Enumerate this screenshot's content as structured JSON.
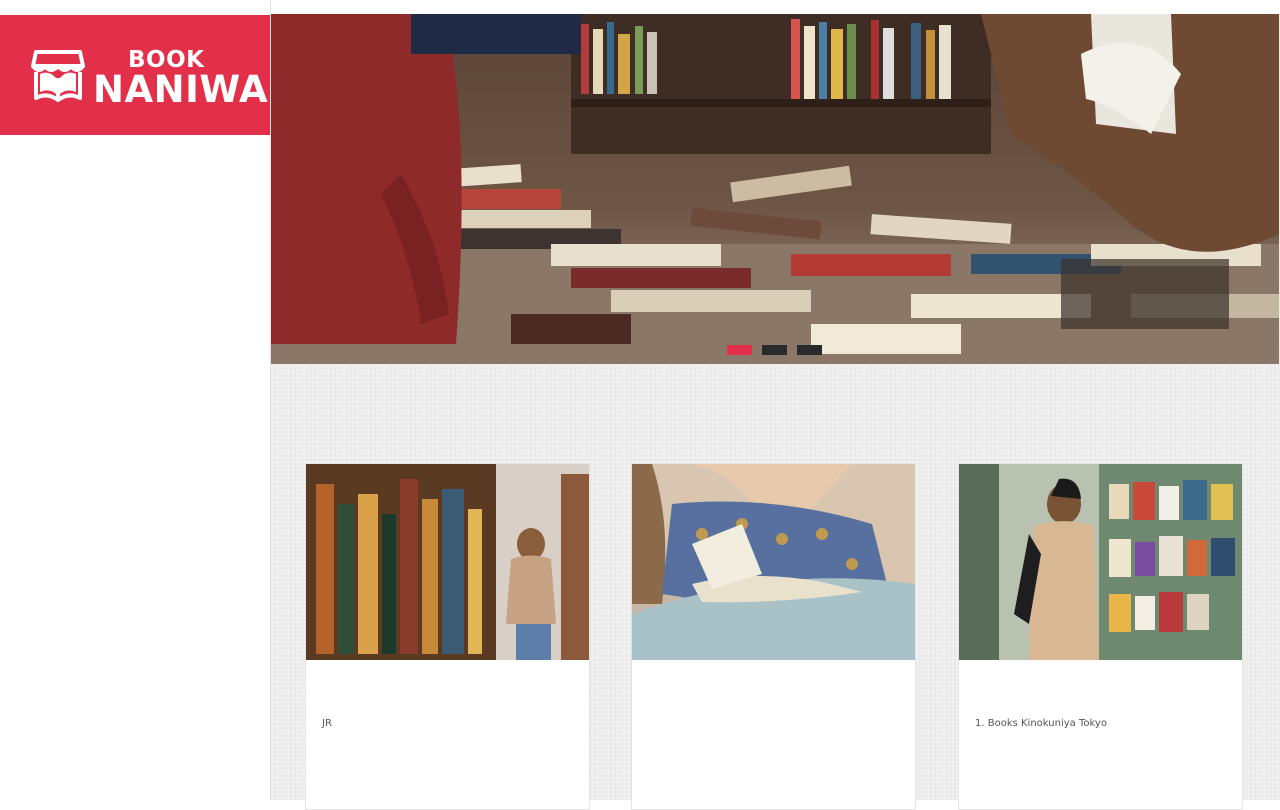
{
  "logo": {
    "line1": "BOOK",
    "line2": "NANIWA",
    "brand_color": "#e3304a"
  },
  "nav": {
    "items": [
      {
        "label": ""
      },
      {
        "label": ""
      },
      {
        "label": ""
      },
      {
        "label": ""
      },
      {
        "label": ""
      },
      {
        "label": ""
      }
    ]
  },
  "hero": {
    "caption": "",
    "slides": [
      {
        "active": true
      },
      {
        "active": false
      },
      {
        "active": false
      }
    ],
    "active_color": "#e3304a"
  },
  "section": {
    "title": ""
  },
  "articles": [
    {
      "title": "",
      "excerpt": "JR"
    },
    {
      "title": "",
      "excerpt": ""
    },
    {
      "title": "",
      "excerpt": "1. Books Kinokuniya Tokyo "
    }
  ]
}
